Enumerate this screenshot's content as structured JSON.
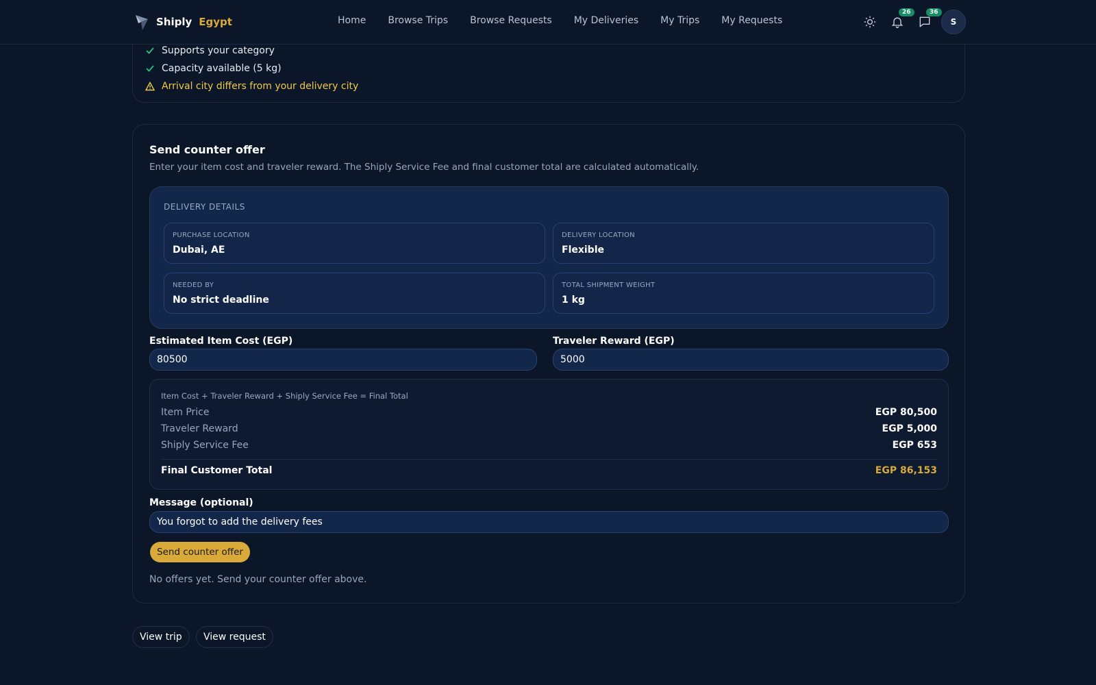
{
  "header": {
    "brand_name": "Shiply",
    "brand_region": "Egypt",
    "nav": [
      "Home",
      "Browse Trips",
      "Browse Requests",
      "My Deliveries",
      "My Trips",
      "My Requests"
    ],
    "notifications_count": "26",
    "messages_count": "36",
    "avatar_initial": "S"
  },
  "match_checks": [
    {
      "status": "ok",
      "text": "Supports your category"
    },
    {
      "status": "ok",
      "text": "Capacity available (5 kg)"
    },
    {
      "status": "warning",
      "text": "Arrival city differs from your delivery city"
    }
  ],
  "counter_offer": {
    "title": "Send counter offer",
    "subtitle": "Enter your item cost and traveler reward. The Shiply Service Fee and final customer total are calculated automatically.",
    "details_label": "DELIVERY DETAILS",
    "details": {
      "purchase_location": {
        "label": "PURCHASE LOCATION",
        "value": "Dubai, AE"
      },
      "delivery_location": {
        "label": "DELIVERY LOCATION",
        "value": "Flexible"
      },
      "needed_by": {
        "label": "NEEDED BY",
        "value": "No strict deadline"
      },
      "total_weight": {
        "label": "TOTAL SHIPMENT WEIGHT",
        "value": "1 kg"
      }
    },
    "item_cost_label": "Estimated Item Cost (EGP)",
    "item_cost_value": "80500",
    "traveler_reward_label": "Traveler Reward (EGP)",
    "traveler_reward_value": "5000",
    "summary": {
      "formula": "Item Cost + Traveler Reward + Shiply Service Fee = Final Total",
      "item_price_label": "Item Price",
      "item_price_value": "EGP 80,500",
      "traveler_reward_label": "Traveler Reward",
      "traveler_reward_value": "EGP 5,000",
      "service_fee_label": "Shiply Service Fee",
      "service_fee_value": "EGP 653",
      "total_label": "Final Customer Total",
      "total_value": "EGP 86,153"
    },
    "message_label": "Message (optional)",
    "message_value": "You forgot to add the delivery fees",
    "send_button": "Send counter offer",
    "no_offers_text": "No offers yet. Send your counter offer above."
  },
  "footer_buttons": {
    "view_trip": "View trip",
    "view_request": "View request"
  },
  "colors": {
    "background": "#0b1628",
    "accent": "#d9a93a",
    "success": "#2fbf7a",
    "warning": "#f2c94c",
    "badge": "#1c8a66"
  }
}
